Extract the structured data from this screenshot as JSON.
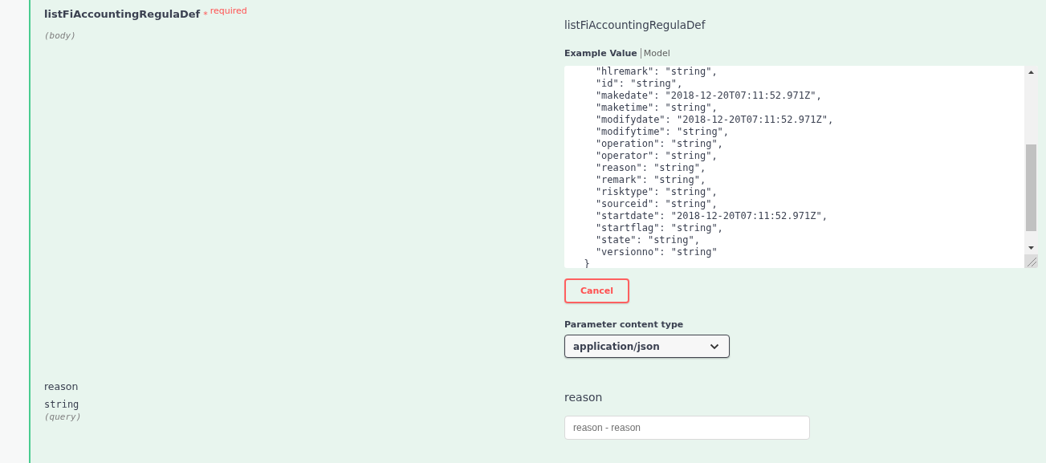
{
  "parameters": [
    {
      "kind": "body",
      "name": "listFiAccountingRegulaDef",
      "required_mark": "*",
      "required_text": "required",
      "location": "(body)",
      "schema_title": "listFiAccountingRegulaDef",
      "example_tabs": [
        {
          "label": "Example Value",
          "selected": true
        },
        {
          "label": "Model",
          "selected": false
        }
      ],
      "example_lines": [
        "    \"hlremark\": \"string\",",
        "    \"id\": \"string\",",
        "    \"makedate\": \"2018-12-20T07:11:52.971Z\",",
        "    \"maketime\": \"string\",",
        "    \"modifydate\": \"2018-12-20T07:11:52.971Z\",",
        "    \"modifytime\": \"string\",",
        "    \"operation\": \"string\",",
        "    \"operator\": \"string\",",
        "    \"reason\": \"string\",",
        "    \"remark\": \"string\",",
        "    \"risktype\": \"string\",",
        "    \"sourceid\": \"string\",",
        "    \"startdate\": \"2018-12-20T07:11:52.971Z\",",
        "    \"startflag\": \"string\",",
        "    \"state\": \"string\",",
        "    \"versionno\": \"string\"",
        "  }"
      ],
      "cancel_label": "Cancel",
      "content_type_label": "Parameter content type",
      "content_type_value": "application/json"
    },
    {
      "kind": "query",
      "name": "reason",
      "type": "string",
      "location": "(query)",
      "field_label": "reason",
      "placeholder": "reason - reason"
    }
  ]
}
